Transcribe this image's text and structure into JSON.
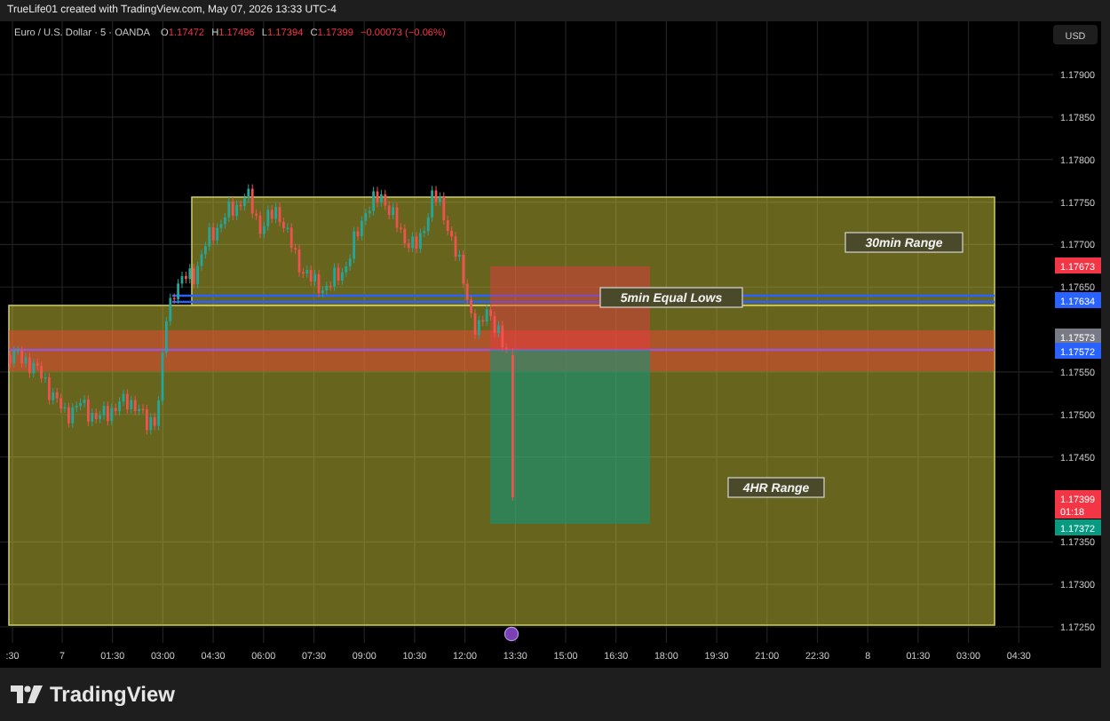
{
  "header": {
    "caption": "TrueLife01 created with TradingView.com, May 07, 2026 13:33 UTC-4"
  },
  "legend": {
    "symbol": "Euro / U.S. Dollar · 5 · OANDA",
    "ohlc": [
      {
        "label": "O",
        "value": "1.17472"
      },
      {
        "label": "H",
        "value": "1.17496"
      },
      {
        "label": "L",
        "value": "1.17394"
      },
      {
        "label": "C",
        "value": "1.17399"
      }
    ],
    "change": "−0.00073 (−0.06%)"
  },
  "price_axis": {
    "currency": "USD",
    "ticks": [
      "1.17900",
      "1.17850",
      "1.17800",
      "1.17750",
      "1.17700",
      "1.17650",
      "1.17550",
      "1.17500",
      "1.17450",
      "1.17350",
      "1.17300",
      "1.17250"
    ],
    "tags": [
      {
        "price": "1.17673",
        "color": "#f23645"
      },
      {
        "price": "1.17634",
        "color": "#2962ff"
      },
      {
        "price": "1.17573",
        "color": "#787b86"
      },
      {
        "price": "1.17572",
        "color": "#2962ff"
      },
      {
        "price": "1.17399",
        "countdown": "01:18",
        "color": "#f23645"
      },
      {
        "price": "1.17372",
        "color": "#089981"
      }
    ]
  },
  "time_axis": {
    "ticks": [
      ":30",
      "7",
      "01:30",
      "03:00",
      "04:30",
      "06:00",
      "07:30",
      "09:00",
      "10:30",
      "12:00",
      "13:30",
      "15:00",
      "16:30",
      "18:00",
      "19:30",
      "21:00",
      "22:30",
      "8",
      "01:30",
      "03:00",
      "04:30"
    ]
  },
  "drawings": [
    {
      "kind": "label",
      "text": "30min Range"
    },
    {
      "kind": "label",
      "text": "5min Equal Lows"
    },
    {
      "kind": "label",
      "text": "4HR Range"
    }
  ],
  "footer": {
    "brand": "TradingView"
  }
}
